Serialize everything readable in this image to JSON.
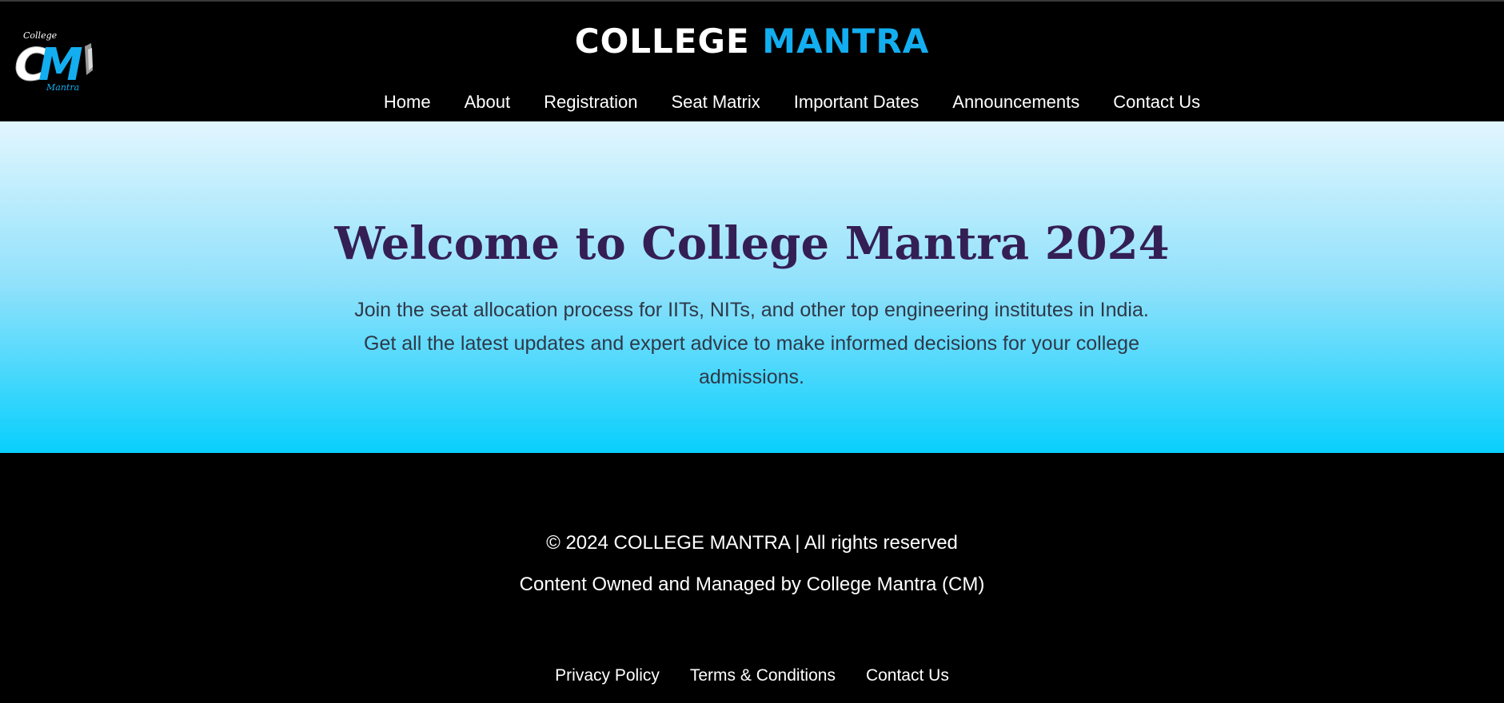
{
  "header": {
    "logo": {
      "icon": "college-mantra-logo",
      "top_text": "College",
      "initials": "CM",
      "bottom_text": "Mantra"
    },
    "title_part1": "COLLEGE",
    "title_part2": "MANTRA",
    "nav": [
      {
        "label": "Home"
      },
      {
        "label": "About"
      },
      {
        "label": "Registration"
      },
      {
        "label": "Seat Matrix"
      },
      {
        "label": "Important Dates"
      },
      {
        "label": "Announcements"
      },
      {
        "label": "Contact Us"
      }
    ]
  },
  "hero": {
    "heading": "Welcome to College Mantra 2024",
    "description": "Join the seat allocation process for IITs, NITs, and other top engineering institutes in India. Get all the latest updates and expert advice to make informed decisions for your college admissions."
  },
  "footer": {
    "copyright": "© 2024 COLLEGE MANTRA | All rights reserved",
    "ownership": "Content Owned and Managed by College Mantra (CM)",
    "links": [
      {
        "label": "Privacy Policy"
      },
      {
        "label": "Terms & Conditions"
      },
      {
        "label": "Contact Us"
      }
    ]
  },
  "colors": {
    "accent": "#13aef0",
    "heading": "#341f55",
    "hero_top": "#e2f6fe",
    "hero_bottom": "#08cffd",
    "background": "#000000"
  }
}
